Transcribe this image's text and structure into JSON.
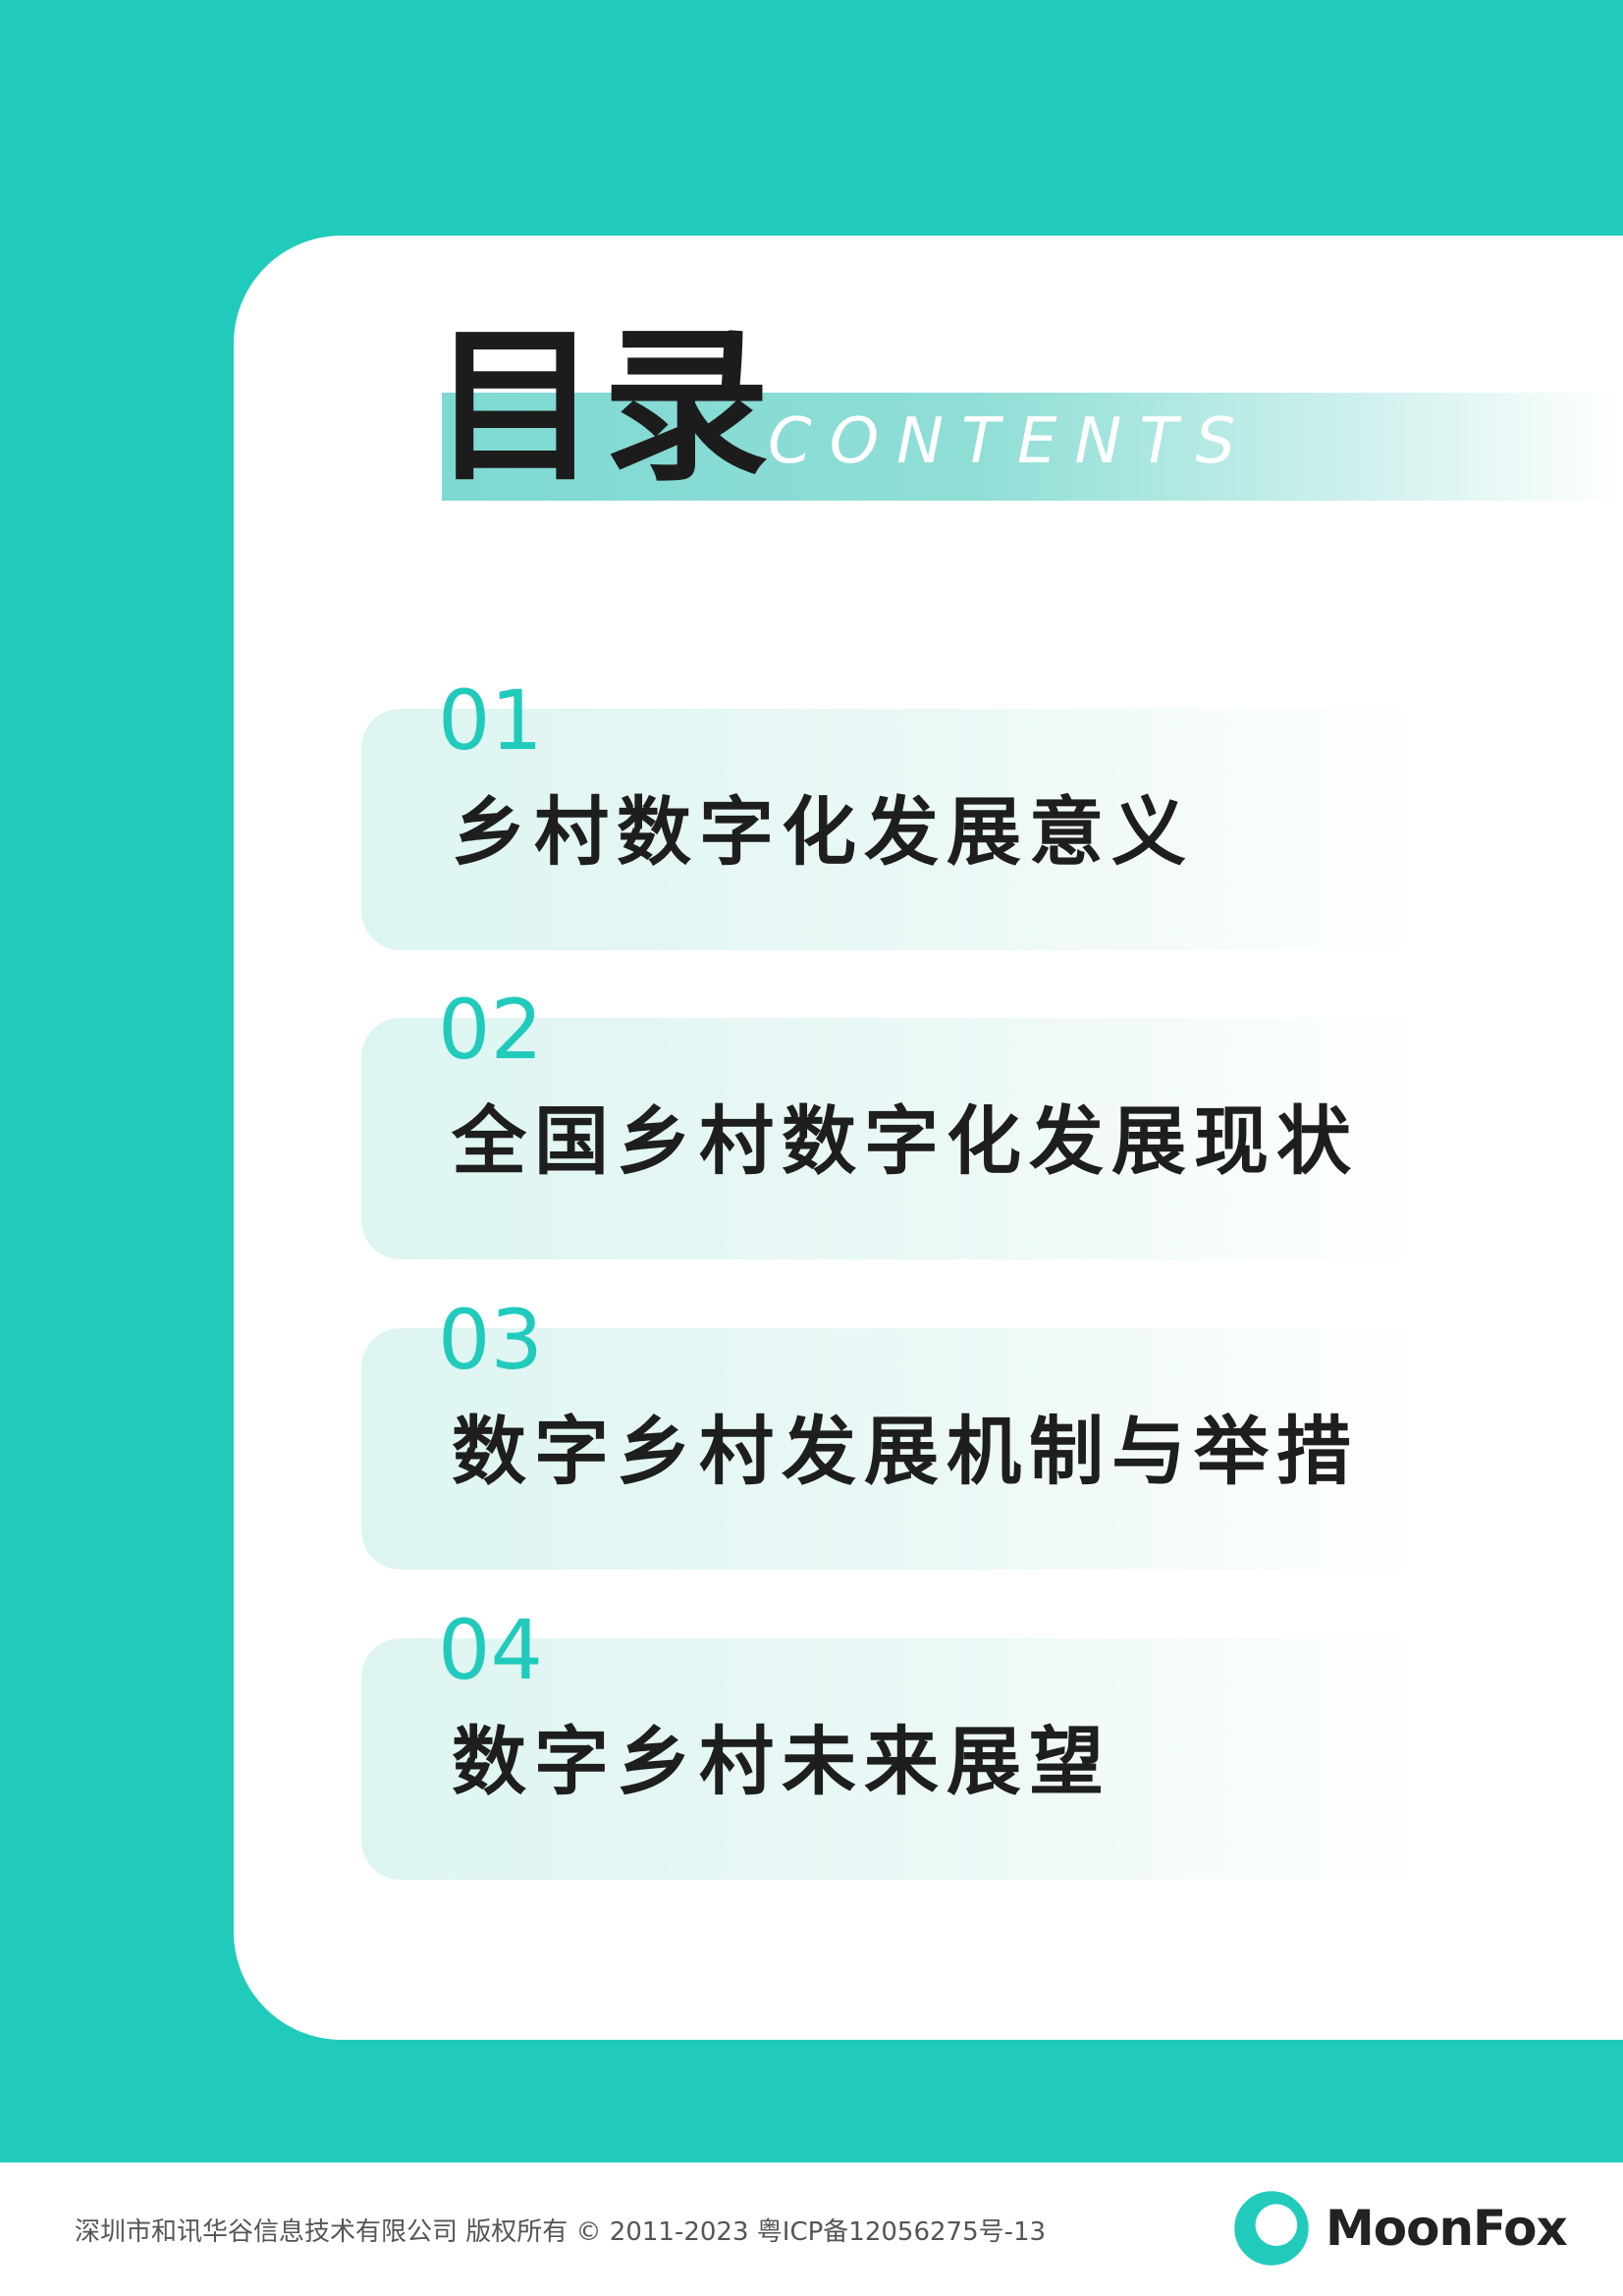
{
  "header": {
    "title_cn": "目录",
    "title_en": "CONTENTS"
  },
  "toc": [
    {
      "number": "01",
      "title": "乡村数字化发展意义"
    },
    {
      "number": "02",
      "title": "全国乡村数字化发展现状"
    },
    {
      "number": "03",
      "title": "数字乡村发展机制与举措"
    },
    {
      "number": "04",
      "title": "数字乡村未来展望"
    }
  ],
  "footer": {
    "copyright": "深圳市和讯华谷信息技术有限公司 版权所有 © 2011-2023 粤ICP备12056275号-13",
    "brand": "MoonFox"
  },
  "colors": {
    "accent": "#21CBBC",
    "text": "#1e1e1e"
  },
  "icons": {
    "logo": "moonfox-logo-icon"
  }
}
